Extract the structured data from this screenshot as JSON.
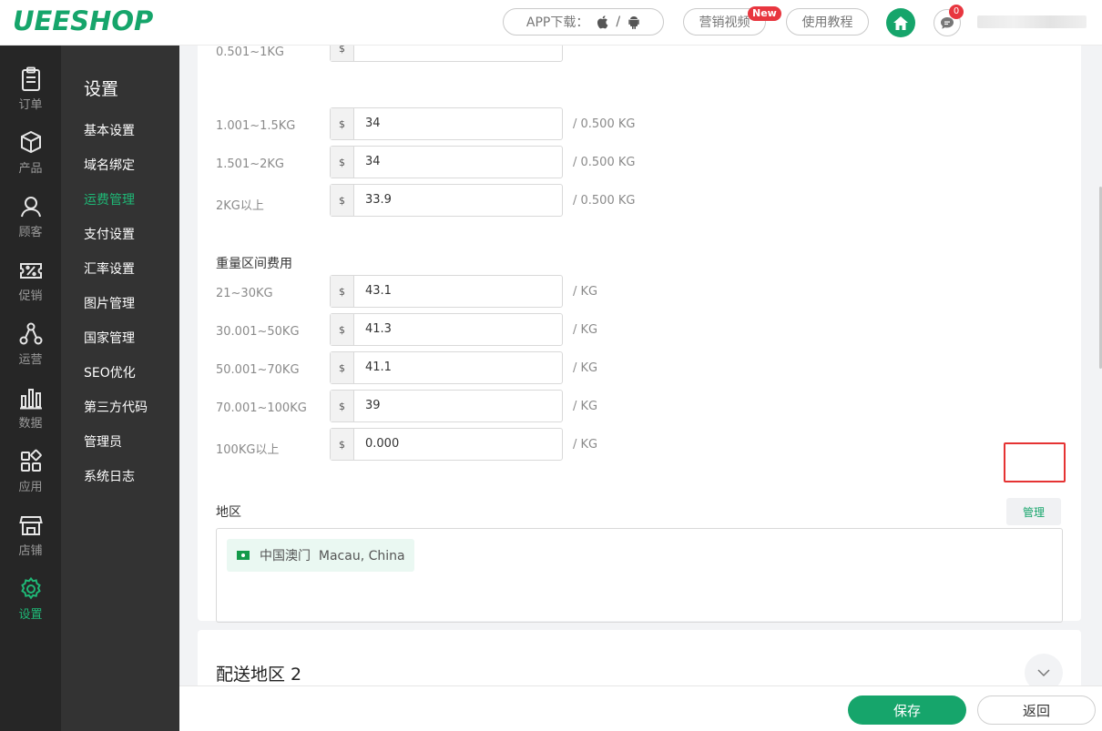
{
  "header": {
    "logo": "UEESHOP",
    "app_download_label": "APP下载：",
    "app_sep": "/",
    "video_label": "营销视频",
    "new_badge": "New",
    "tutorial_label": "使用教程",
    "message_count": "0"
  },
  "rail": [
    {
      "label": "订单",
      "icon": "clipboard-icon"
    },
    {
      "label": "产品",
      "icon": "box-icon"
    },
    {
      "label": "顾客",
      "icon": "user-icon"
    },
    {
      "label": "促销",
      "icon": "percent-ticket-icon"
    },
    {
      "label": "运营",
      "icon": "network-icon"
    },
    {
      "label": "数据",
      "icon": "bar-chart-icon"
    },
    {
      "label": "应用",
      "icon": "apps-icon"
    },
    {
      "label": "店铺",
      "icon": "store-icon"
    },
    {
      "label": "设置",
      "icon": "gear-icon",
      "active": true
    }
  ],
  "subnav": {
    "title": "设置",
    "items": [
      "基本设置",
      "域名绑定",
      "运费管理",
      "支付设置",
      "汇率设置",
      "图片管理",
      "国家管理",
      "SEO优化",
      "第三方代码",
      "管理员",
      "系统日志"
    ],
    "active_index": 2
  },
  "currency": "$",
  "partial_row_label": "0.501~1KG",
  "step_rows": [
    {
      "label": "1.001~1.5KG",
      "value": "34",
      "unit": "/ 0.500 KG"
    },
    {
      "label": "1.501~2KG",
      "value": "34",
      "unit": "/ 0.500 KG"
    },
    {
      "label": "2KG以上",
      "value": "33.9",
      "unit": "/ 0.500 KG"
    }
  ],
  "weight_range": {
    "title": "重量区间费用",
    "rows": [
      {
        "label": "21~30KG",
        "value": "43.1",
        "unit": "/ KG"
      },
      {
        "label": "30.001~50KG",
        "value": "41.3",
        "unit": "/ KG"
      },
      {
        "label": "50.001~70KG",
        "value": "41.1",
        "unit": "/ KG"
      },
      {
        "label": "70.001~100KG",
        "value": "39",
        "unit": "/ KG"
      },
      {
        "label": "100KG以上",
        "value": "0.000",
        "unit": "/ KG"
      }
    ]
  },
  "region": {
    "title": "地区",
    "manage_label": "管理",
    "chip": "中国澳门  Macau, China"
  },
  "zone2": {
    "title": "配送地区 2"
  },
  "footer": {
    "save_label": "保存",
    "back_label": "返回"
  },
  "colors": {
    "brand": "#16a56b",
    "highlight": "#e53333"
  }
}
